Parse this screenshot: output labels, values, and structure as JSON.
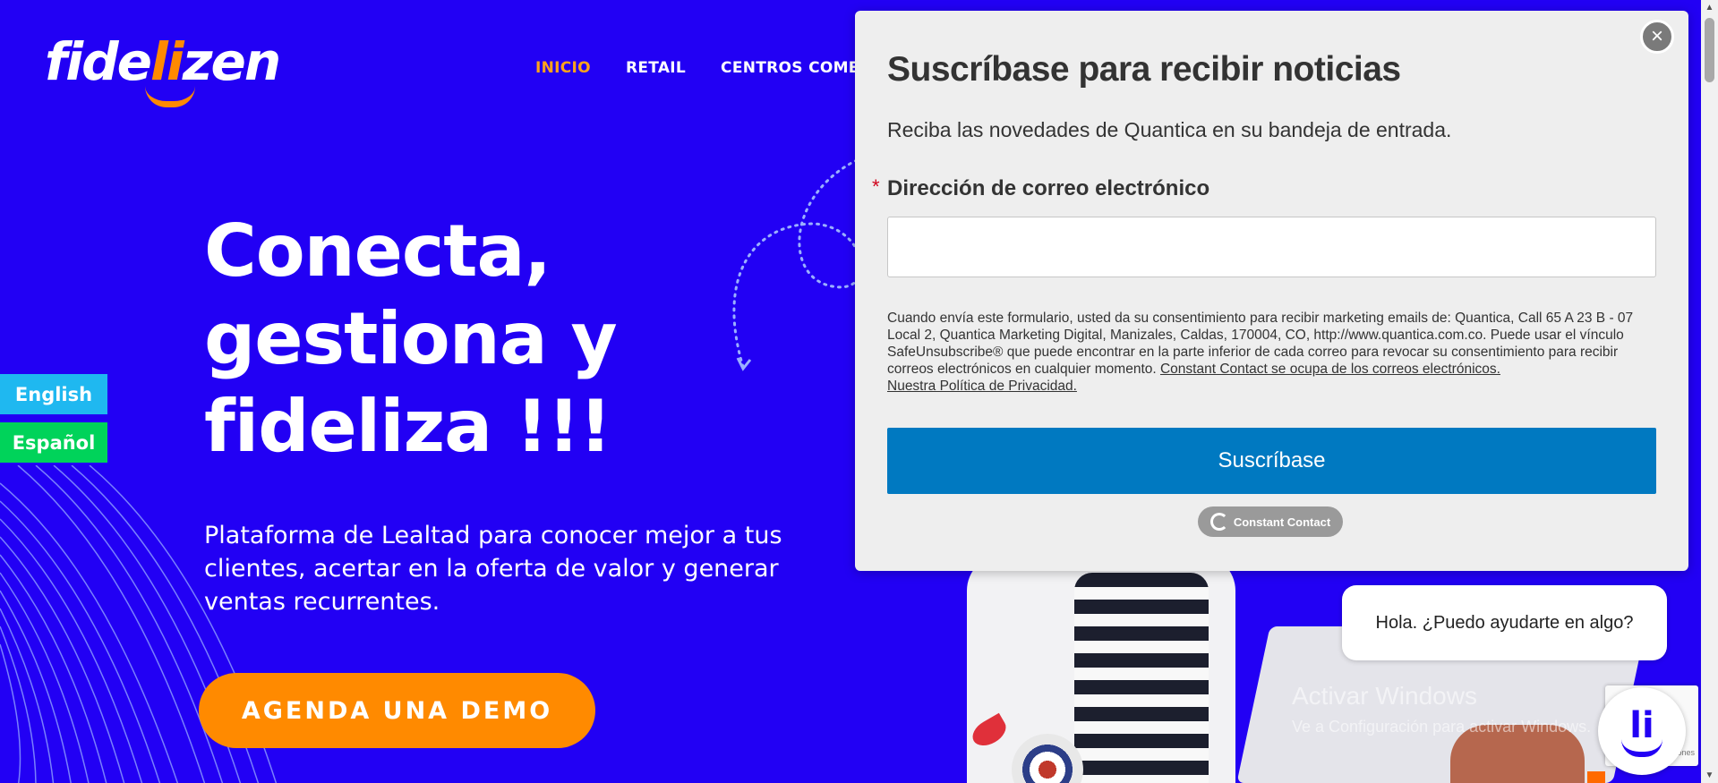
{
  "brand": {
    "logo_text_a": "fide",
    "logo_text_b": "li",
    "logo_text_c": "zen"
  },
  "nav": {
    "items": [
      "INICIO",
      "RETAIL",
      "CENTROS COMERCIALES"
    ]
  },
  "hero": {
    "title_line1": "Conecta,",
    "title_line2": "gestiona y",
    "title_line3": "fideliza !!!",
    "subtitle": "Plataforma de Lealtad para conocer mejor a tus clientes, acertar en la oferta de valor y generar ventas recurrentes.",
    "cta": "AGENDA UNA DEMO"
  },
  "language": {
    "english": "English",
    "spanish": "Español"
  },
  "modal": {
    "close": "×",
    "title": "Suscríbase para recibir noticias",
    "description": "Reciba las novedades de Quantica en su bandeja de entrada.",
    "required_mark": "*",
    "email_label": "Dirección de correo electrónico",
    "email_value": "",
    "consent_text": "Cuando envía este formulario, usted da su consentimiento para recibir marketing emails de: Quantica, Call 65 A 23 B - 07 Local 2, Quantica Marketing Digital, Manizales, Caldas, 170004, CO, http://www.quantica.com.co. Puede usar el vínculo SafeUnsubscribe® que puede encontrar en la parte inferior de cada correo para revocar su consentimiento para recibir correos electrónicos en cualquier momento. ",
    "consent_link1": "Constant Contact se ocupa de los correos electrónicos.",
    "consent_link2": "Nuestra Política de Privacidad.",
    "submit": "Suscríbase",
    "badge": "Constant Contact"
  },
  "chat": {
    "greeting": "Hola. ¿Puedo ayudarte en algo?",
    "avatar": "li"
  },
  "windows": {
    "line1": "Activar Windows",
    "line2": "Ve a Configuración para activar Windows."
  },
  "recaptcha": {
    "mini": "rivacidad - Condiciones"
  },
  "scrollbar": {
    "up": "▲",
    "down": "▼"
  },
  "colors": {
    "background": "#2200f4",
    "accent": "#ff8a00",
    "submit": "#0079c1"
  }
}
